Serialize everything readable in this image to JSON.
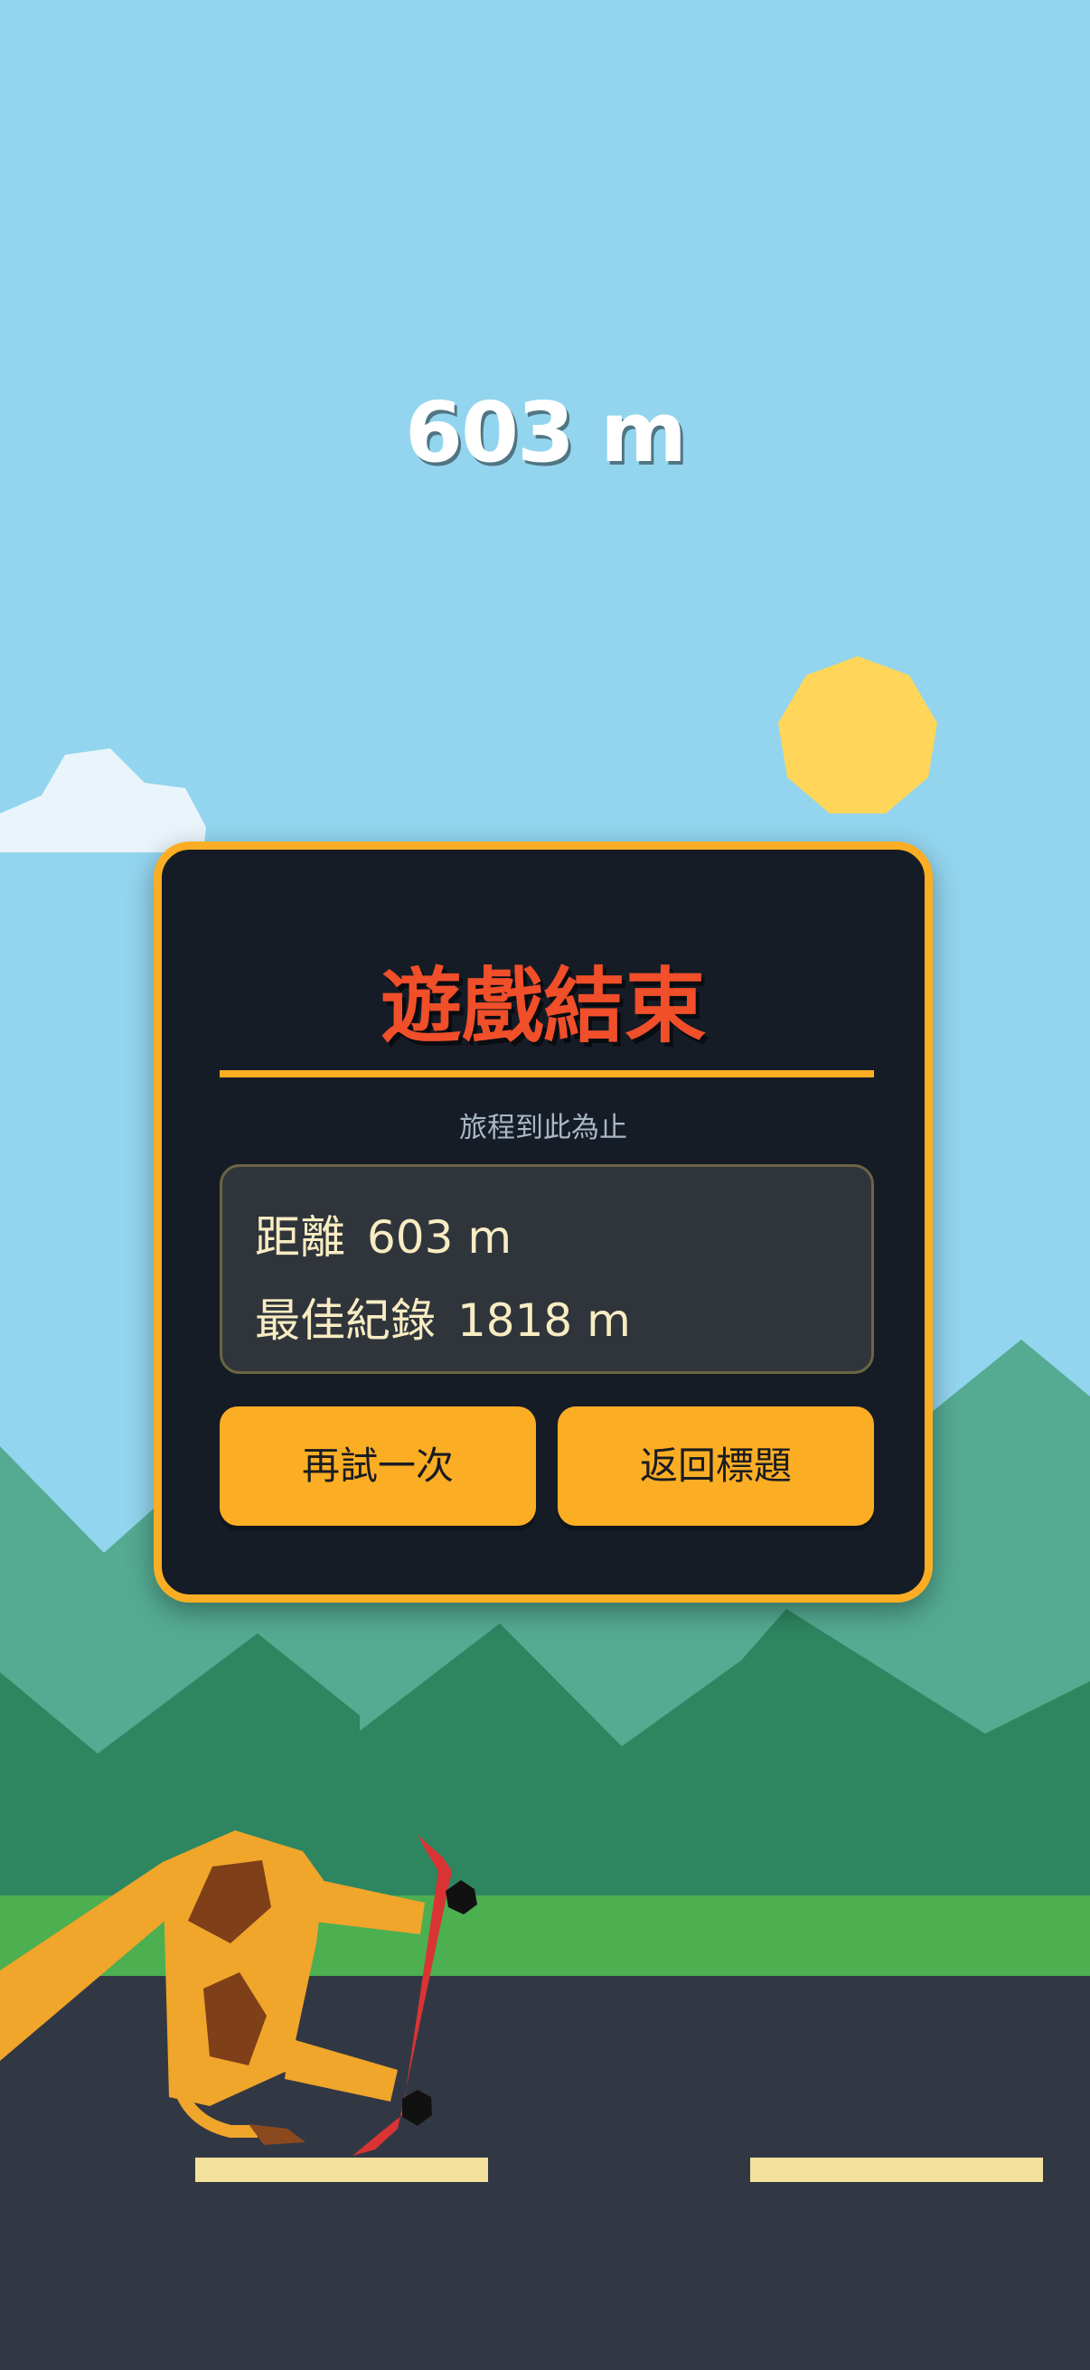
{
  "hud": {
    "distance": "603 m"
  },
  "dialog": {
    "title": "遊戲結束",
    "subtitle": "旅程到此為止",
    "stats": {
      "distance_label": "距離",
      "distance_value": "603 m",
      "best_label": "最佳紀錄",
      "best_value": "1818 m"
    },
    "buttons": {
      "retry": "再試一次",
      "back_to_title": "返回標題"
    }
  },
  "colors": {
    "sky": "#93D5EE",
    "panel_bg": "#161C26",
    "panel_border": "#FBAE24",
    "title": "#F04F2A",
    "button": "#FBAE24",
    "road": "#323843",
    "grass": "#4CAF50",
    "sun": "#FFD55A"
  },
  "icons": {
    "sun": "sun-icon",
    "cloud": "cloud-icon",
    "player": "giraffe-skateboard-icon"
  }
}
